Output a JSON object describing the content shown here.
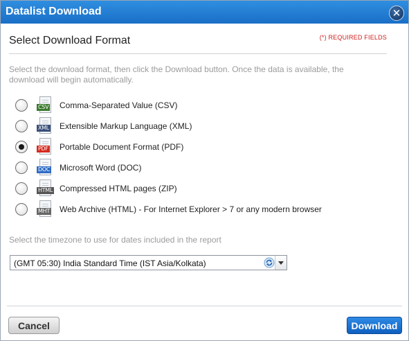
{
  "dialog": {
    "title": "Datalist Download",
    "close_icon": "close-icon",
    "heading": "Select Download Format",
    "required_note": "(*) REQUIRED FIELDS",
    "instructions": "Select the download format, then click the Download button. Once the data is available, the download will begin automatically.",
    "formats": [
      {
        "tag": "CSV",
        "label": "Comma-Separated Value (CSV)",
        "icon": "csv-file-icon",
        "color": "#3b7a2e",
        "checked": false
      },
      {
        "tag": "XML",
        "label": "Extensible Markup Language (XML)",
        "icon": "xml-file-icon",
        "color": "#3a4f7a",
        "checked": false
      },
      {
        "tag": "PDF",
        "label": "Portable Document Format (PDF)",
        "icon": "pdf-file-icon",
        "color": "#d62a1e",
        "checked": true
      },
      {
        "tag": "DOC",
        "label": "Microsoft Word (DOC)",
        "icon": "doc-file-icon",
        "color": "#2f6bc4",
        "checked": false
      },
      {
        "tag": "HTML",
        "label": "Compressed HTML pages (ZIP)",
        "icon": "html-file-icon",
        "color": "#555555",
        "checked": false
      },
      {
        "tag": "MHT",
        "label": "Web Archive (HTML) - For Internet Explorer > 7 or any modern browser",
        "icon": "mht-file-icon",
        "color": "#666666",
        "checked": false
      }
    ],
    "timezone": {
      "label": "Select the timezone to use for dates included in the report",
      "selected": "(GMT 05:30) India Standard Time (IST Asia/Kolkata)",
      "refresh_icon": "refresh-icon",
      "dropdown_icon": "chevron-down-icon"
    },
    "buttons": {
      "cancel": "Cancel",
      "download": "Download"
    }
  }
}
